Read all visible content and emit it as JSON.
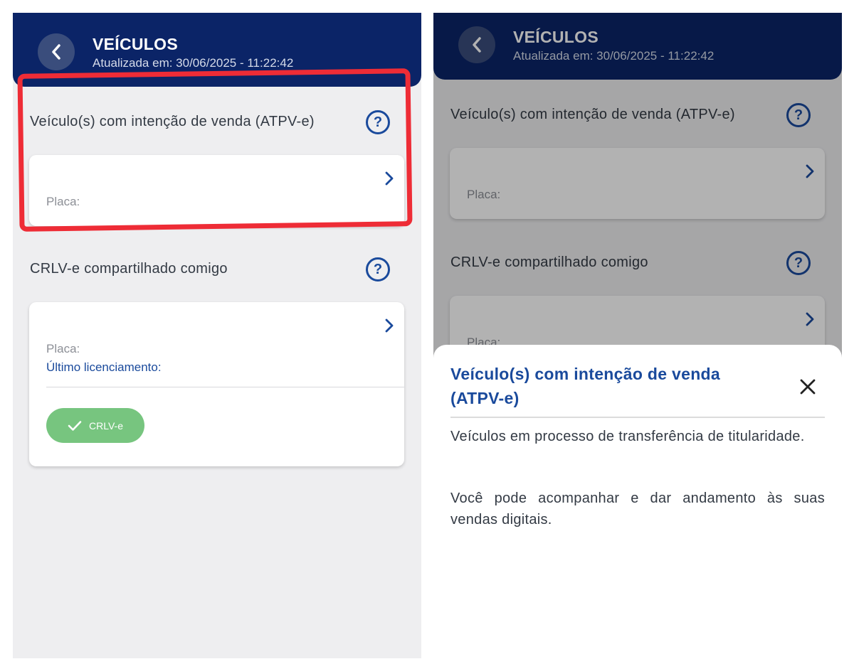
{
  "header": {
    "title": "VEÍCULOS",
    "updated": "Atualizada em: 30/06/2025 - 11:22:42"
  },
  "sections": {
    "atpv": {
      "label": "Veículo(s) com intenção de venda (ATPV-e)",
      "placa_label": "Placa:"
    },
    "crlv": {
      "label": "CRLV-e compartilhado comigo",
      "placa_label": "Placa:",
      "licenciamento_label": "Último licenciamento:",
      "button_label": "CRLV-e"
    }
  },
  "sheet": {
    "title": "Veículo(s) com intenção de venda (ATPV-e)",
    "paragraph1": "Veículos em processo de transferência de titularidade.",
    "paragraph2": "Você pode acompanhar e dar andamento às suas vendas digitais."
  },
  "colors": {
    "header_bg": "#0b2467",
    "accent_blue": "#1a4a9c",
    "crlv_button_green": "#77c57f",
    "highlight_red": "#ee2c36"
  }
}
